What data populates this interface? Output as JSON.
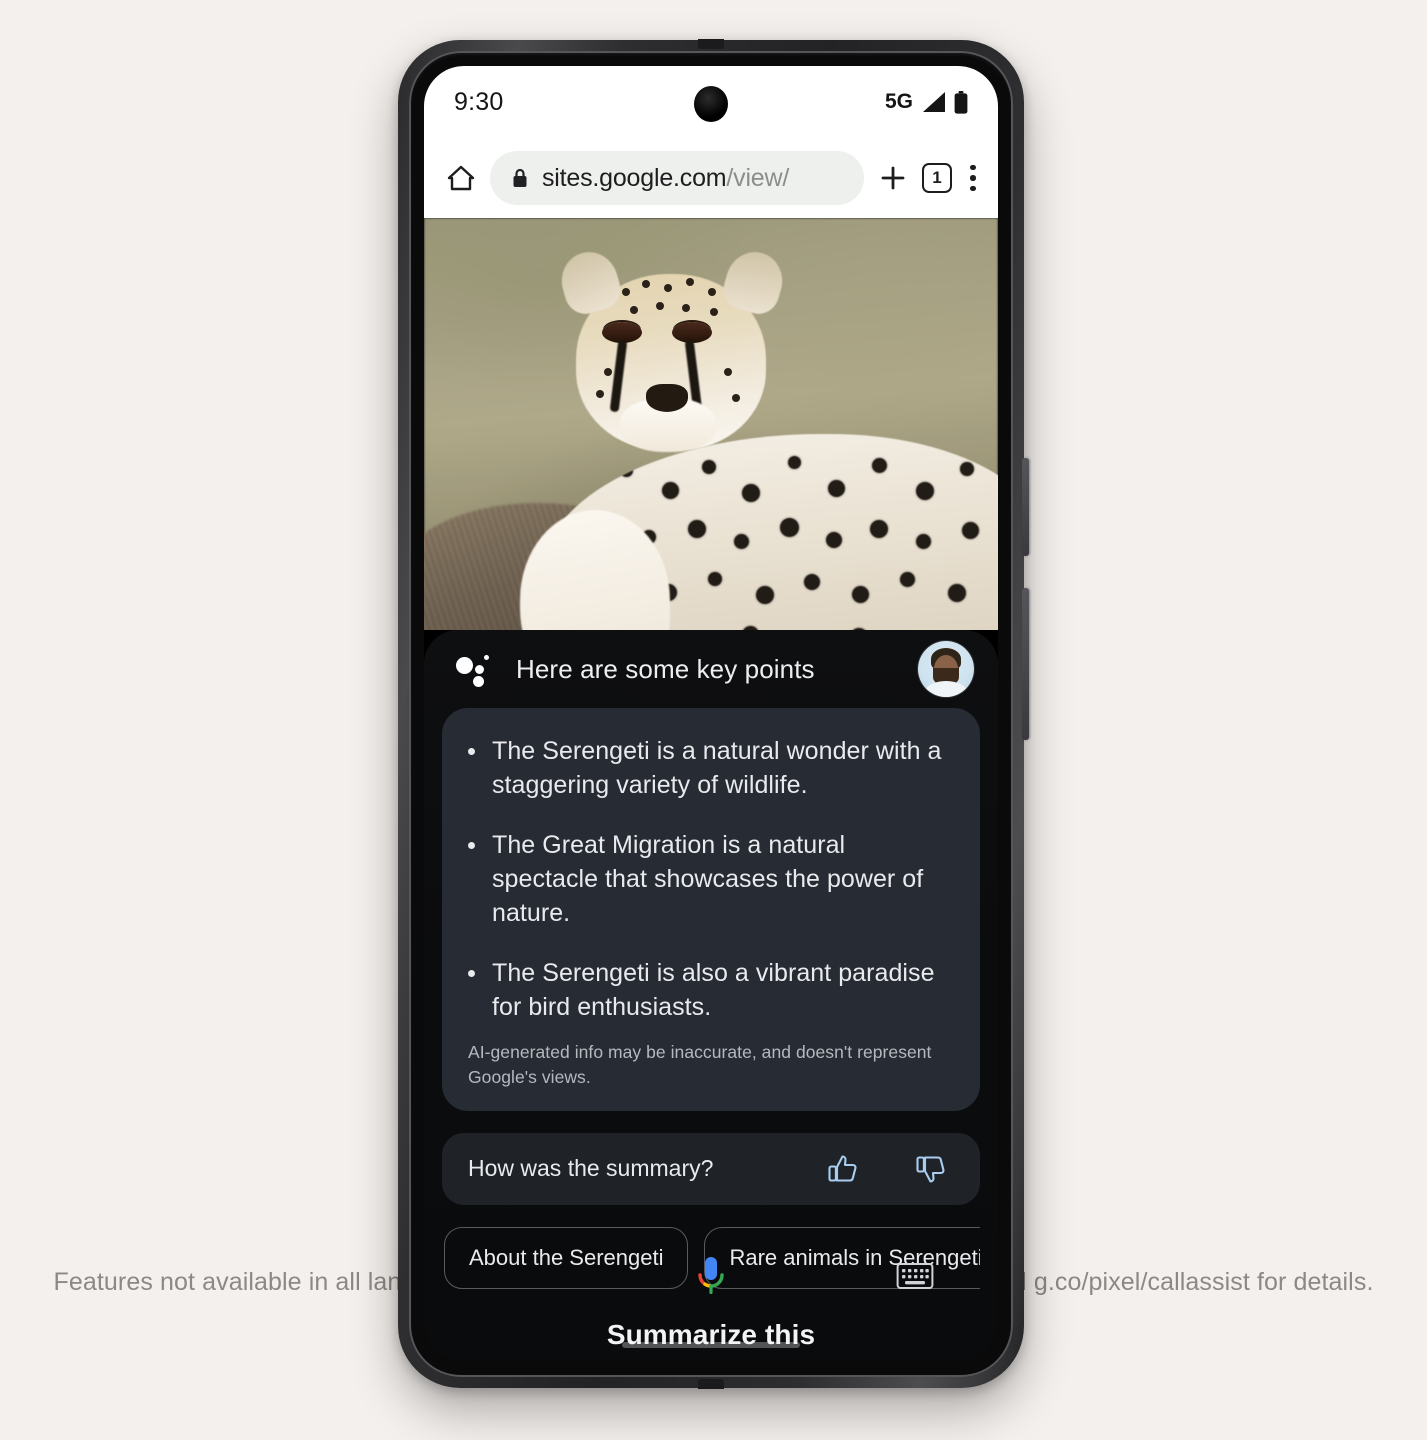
{
  "page": {
    "background_color": "#f4f0ed",
    "caption": "Features not available in all languages or countries. See g.co/pixel/googleassistant and g.co/pixel/callassist for details."
  },
  "phone": {
    "status_bar": {
      "clock": "9:30",
      "network_label": "5G",
      "signal_icon": "signal-bars-icon",
      "battery_icon": "battery-full-icon",
      "camera_icon": "front-camera-punch-hole"
    },
    "browser": {
      "home_icon": "home-icon",
      "lock_icon": "lock-icon",
      "url_primary": "sites.google.com",
      "url_secondary": "/view/",
      "new_tab_icon": "plus-icon",
      "tab_count": "1",
      "menu_icon": "kebab-menu-icon"
    },
    "hero": {
      "alt": "cheetah resting on termite mound in Serengeti grassland"
    }
  },
  "assistant": {
    "logo_icon": "google-assistant-sparkle-icon",
    "title": "Here are some key points",
    "avatar": "user-avatar",
    "summary": {
      "bullets": [
        "The Serengeti is a natural wonder with a staggering variety of wildlife.",
        "The Great Migration is a natural spectacle that showcases the power of nature.",
        "The Serengeti is also a vibrant paradise for bird enthusiasts."
      ],
      "disclaimer": "AI-generated info may be inaccurate, and doesn't represent Google's views."
    },
    "feedback": {
      "label": "How was the summary?",
      "thumbs_up_icon": "thumbs-up-icon",
      "thumbs_down_icon": "thumbs-down-icon",
      "accent_color": "#a8cdf0"
    },
    "chips": [
      {
        "label": "About the Serengeti"
      },
      {
        "label": "Rare animals in Serengeti"
      }
    ],
    "footer": {
      "title": "Summarize this",
      "mic_icon": "google-mic-icon",
      "keyboard_icon": "keyboard-icon"
    }
  }
}
